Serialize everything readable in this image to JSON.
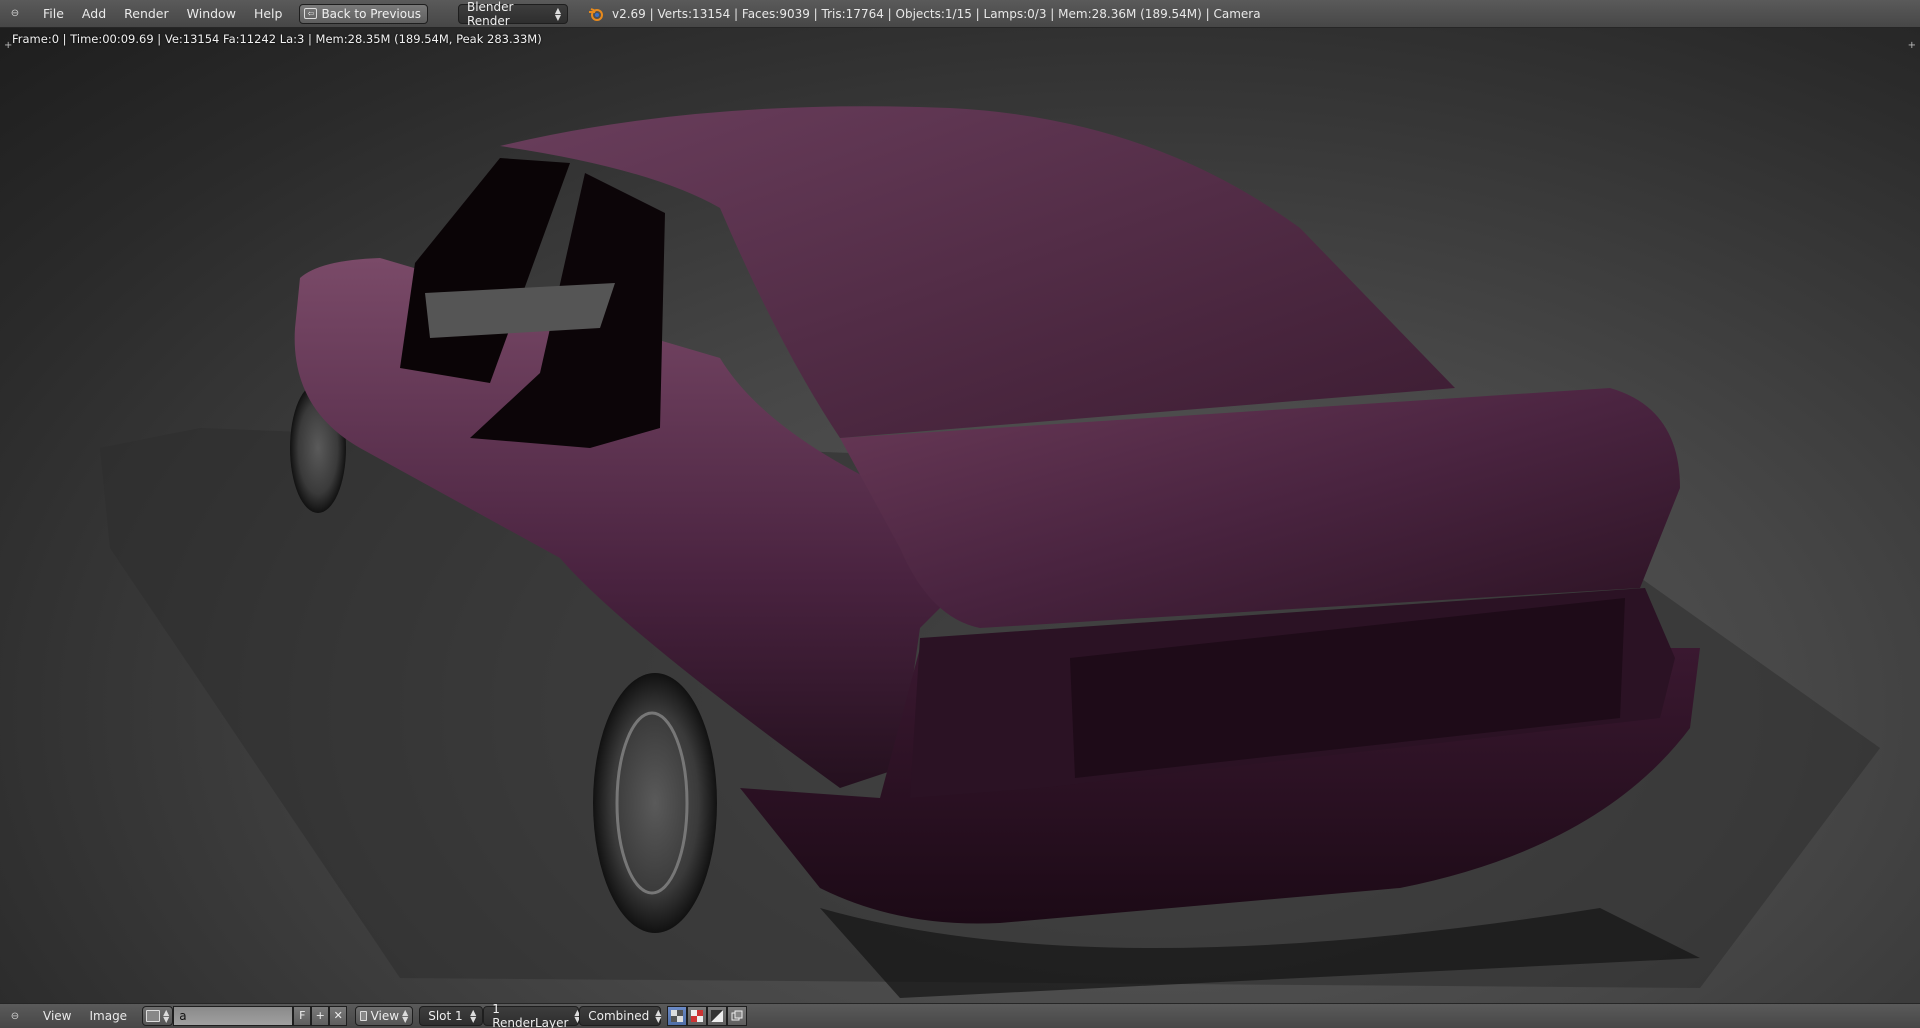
{
  "topbar": {
    "menus": [
      "File",
      "Add",
      "Render",
      "Window",
      "Help"
    ],
    "back_button": "Back to Previous",
    "render_engine": "Blender Render",
    "stats": "v2.69 | Verts:13154 | Faces:9039 | Tris:17764 | Objects:1/15 | Lamps:0/3 | Mem:28.36M (189.54M) | Camera"
  },
  "viewport": {
    "render_info": "Frame:0 | Time:00:09.69 | Ve:13154 Fa:11242 La:3 | Mem:28.35M (189.54M, Peak 283.33M)"
  },
  "bottombar": {
    "menus": [
      "View",
      "Image"
    ],
    "image_name": "a",
    "fake_user": "F",
    "view_label": "View",
    "slot": "Slot 1",
    "render_layer": "1 RenderLayer",
    "pass": "Combined"
  },
  "colors": {
    "car_body": "#5a2e4a",
    "car_dark": "#2a1020",
    "header_bg": "#4f4f4f",
    "active_accent": "#5a7cc0"
  },
  "icons": [
    "editor-type-icon",
    "back-arrow-icon",
    "blender-logo-icon",
    "image-browse-icon",
    "add-new-icon",
    "unlink-icon",
    "alpha-icons"
  ]
}
